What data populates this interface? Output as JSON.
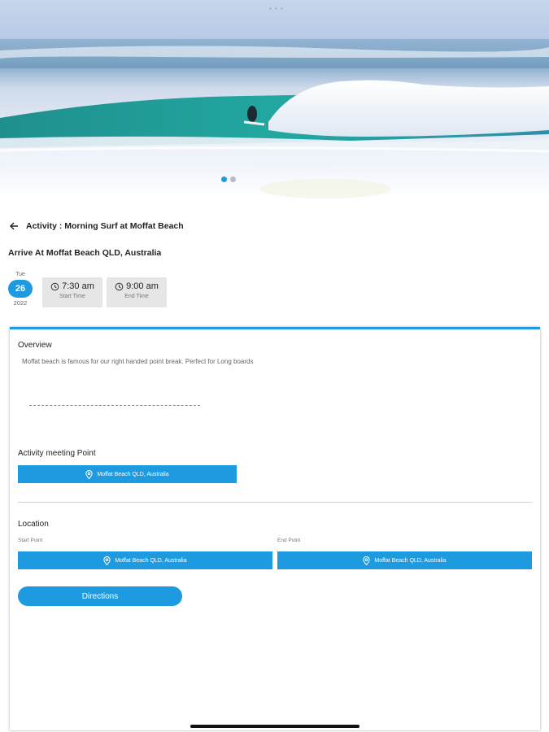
{
  "header": {
    "title": "Activity : Morning Surf at Moffat Beach",
    "arrive": "Arrive At Moffat Beach QLD, Australia"
  },
  "hero": {
    "status_dots": "• • •",
    "pager_count": 2,
    "pager_active": 1
  },
  "date": {
    "dow": "Tue",
    "day": "26",
    "year": "2022"
  },
  "times": {
    "start": {
      "value": "7:30 am",
      "label": "Start Time"
    },
    "end": {
      "value": "9:00 am",
      "label": "End Time"
    }
  },
  "overview": {
    "title": "Overview",
    "text": "Moffat beach is famous for our right handed point break. Perfect for Long boards"
  },
  "meeting": {
    "title": "Activity meeting Point",
    "place": "Moffat Beach QLD, Australia"
  },
  "location": {
    "title": "Location",
    "start_label": "Start Point",
    "start_place": "Moffat Beach QLD, Australia",
    "end_label": "End Point",
    "end_place": "Moffat Beach QLD, Australia"
  },
  "actions": {
    "directions": "Directions"
  },
  "colors": {
    "accent": "#1e9be0",
    "time_bg": "#e6e6e6"
  },
  "icons": [
    "back-arrow-icon",
    "clock-icon",
    "location-pin-icon"
  ]
}
